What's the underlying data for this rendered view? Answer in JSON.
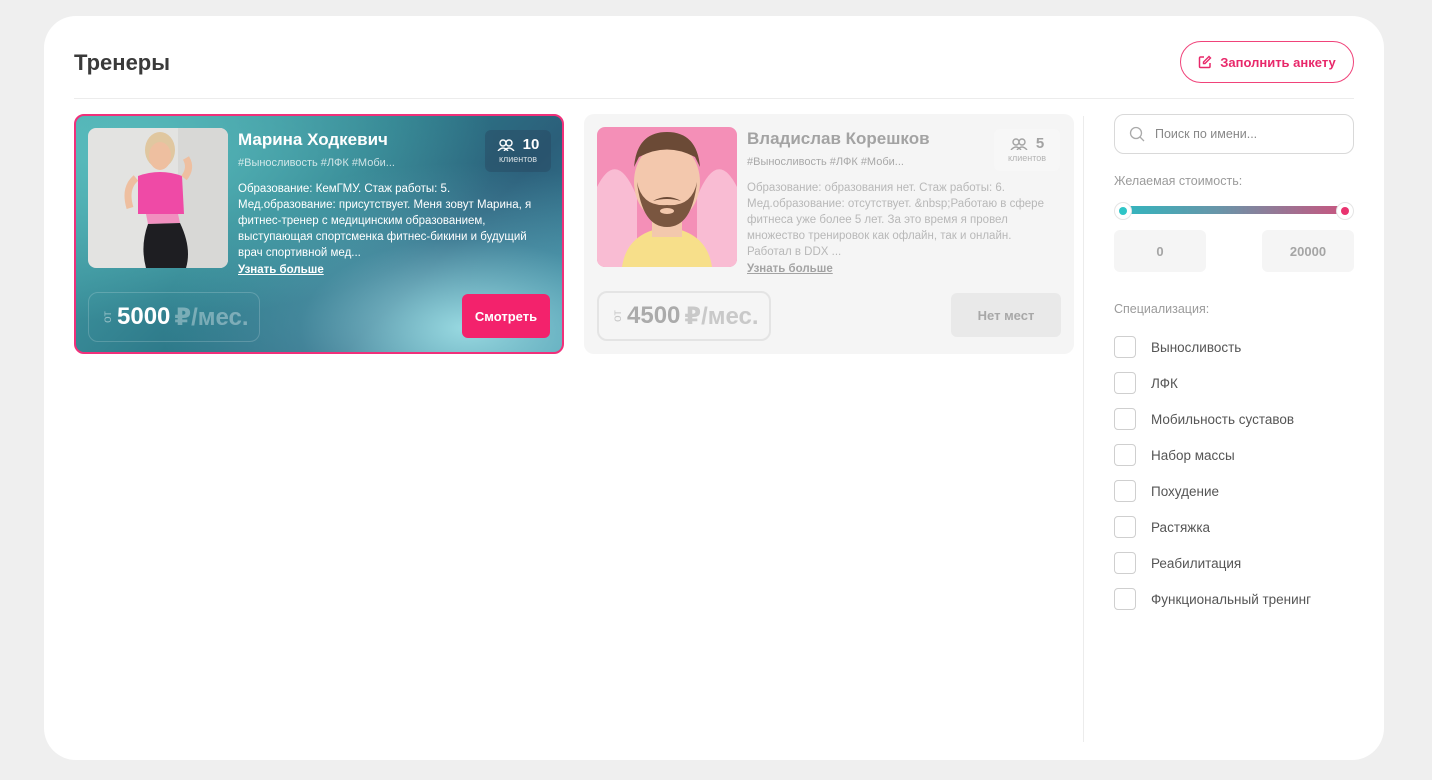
{
  "header": {
    "title": "Тренеры",
    "fill_button": "Заполнить анкету"
  },
  "trainers": [
    {
      "name": "Марина Ходкевич",
      "tags": "#Выносливость #ЛФК #Моби...",
      "clients_count": "10",
      "clients_label": "клиентов",
      "description": "Образование: КемГМУ. Стаж работы: 5. Мед.образование: присутствует. Меня зовут Марина, я фитнес-тренер с медицинским образованием, выступающая спортсменка фитнес-бикини и будущий врач спортивной мед...",
      "more_link": "Узнать больше",
      "price_from": "от",
      "price": "5000",
      "price_unit": "₽/мес.",
      "action": "Смотреть"
    },
    {
      "name": "Владислав Корешков",
      "tags": "#Выносливость #ЛФК #Моби...",
      "clients_count": "5",
      "clients_label": "клиентов",
      "description": "Образование: образования нет. Стаж работы: 6. Мед.образование: отсутствует. &nbsp;Работаю в сфере фитнеса уже более 5 лет. За это время я провел множество тренировок как офлайн, так и онлайн. Работал в DDX ...",
      "more_link": "Узнать больше",
      "price_from": "от",
      "price": "4500",
      "price_unit": "₽/мес.",
      "action": "Нет мест"
    }
  ],
  "filters": {
    "search_placeholder": "Поиск по имени...",
    "price_label": "Желаемая стоимость:",
    "price_min": "0",
    "price_max": "20000",
    "spec_label": "Специализация:",
    "specializations": [
      "Выносливость",
      "ЛФК",
      "Мобильность суставов",
      "Набор массы",
      "Похудение",
      "Растяжка",
      "Реабилитация",
      "Функциональный тренинг"
    ]
  },
  "colors": {
    "accent": "#f3226c",
    "teal": "#2fb7bf"
  },
  "icons": {
    "fill_button": "edit-icon",
    "clients": "users-icon",
    "search": "search-icon"
  }
}
